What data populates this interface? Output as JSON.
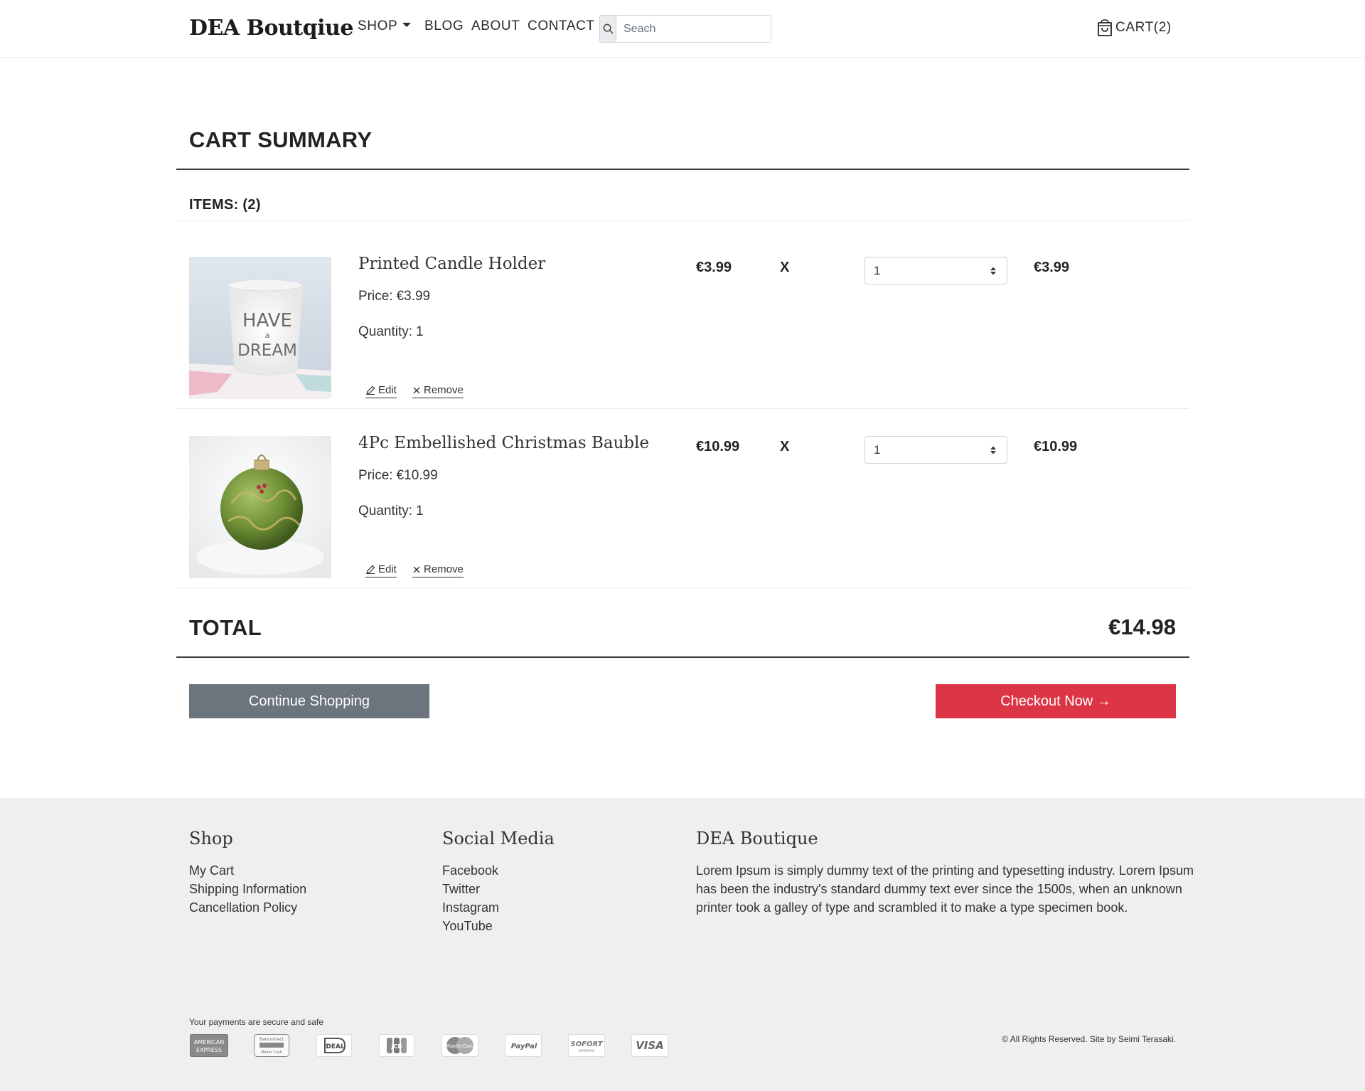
{
  "header": {
    "brand": "DEA Boutqiue",
    "nav": {
      "shop": "SHOP",
      "blog": "BLOG",
      "about": "ABOUT",
      "contact": "CONTACT"
    },
    "search": {
      "placeholder": "Seach"
    },
    "cart": {
      "label": "CART",
      "count": "(2)"
    }
  },
  "cart": {
    "title": "CART SUMMARY",
    "items_label": "ITEMS: (2)",
    "items": [
      {
        "name": "Printed Candle Holder",
        "price_label": "Price:",
        "price": "€3.99",
        "quantity_label": "Quantity:",
        "quantity": "1",
        "unit_price": "€3.99",
        "multiplier": "X",
        "selected_qty": "1",
        "line_total": "€3.99",
        "edit_label": "Edit",
        "remove_label": "Remove",
        "image_text": {
          "line1": "HAVE",
          "line2": "a",
          "line3": "DREAM"
        }
      },
      {
        "name": "4Pc Embellished Christmas Bauble",
        "price_label": "Price:",
        "price": "€10.99",
        "quantity_label": "Quantity:",
        "quantity": "1",
        "unit_price": "€10.99",
        "multiplier": "X",
        "selected_qty": "1",
        "line_total": "€10.99",
        "edit_label": "Edit",
        "remove_label": "Remove"
      }
    ],
    "total_label": "TOTAL",
    "total_value": "€14.98",
    "continue_label": "Continue Shopping",
    "checkout_label": "Checkout Now →"
  },
  "footer": {
    "shop": {
      "heading": "Shop",
      "links": [
        "My Cart",
        "Shipping Information",
        "Cancellation Policy"
      ]
    },
    "social": {
      "heading": "Social Media",
      "links": [
        "Facebook",
        "Twitter",
        "Instagram",
        "YouTube"
      ]
    },
    "about": {
      "heading": "DEA Boutique",
      "text": "Lorem Ipsum is simply dummy text of the printing and typesetting industry. Lorem Ipsum has been the industry's standard dummy text ever since the 1500s, when an unknown printer took a galley of type and scrambled it to make a type specimen book."
    },
    "secure_text": "Your payments are secure and safe",
    "payment_logos": [
      {
        "icon": "american-express-icon",
        "text1": "AMERICAN",
        "text2": "EXPRESS"
      },
      {
        "icon": "bancontact-icon",
        "text1": "Bancontact",
        "text2": "Mister Cash"
      },
      {
        "icon": "ideal-icon",
        "text1": "iDEAL"
      },
      {
        "icon": "jcb-icon",
        "text1": "JCB"
      },
      {
        "icon": "mastercard-icon",
        "text1": "MasterCard"
      },
      {
        "icon": "paypal-icon",
        "text1": "PayPal"
      },
      {
        "icon": "sofort-icon",
        "text1": "SOFORT",
        "text2": "BANKING"
      },
      {
        "icon": "visa-icon",
        "text1": "VISA"
      }
    ],
    "copyright": "© All Rights Reserved. Site by Seimi Terasaki."
  },
  "colors": {
    "accent_red": "#dc3545",
    "secondary_gray": "#6c757d",
    "footer_bg": "#efefef"
  }
}
